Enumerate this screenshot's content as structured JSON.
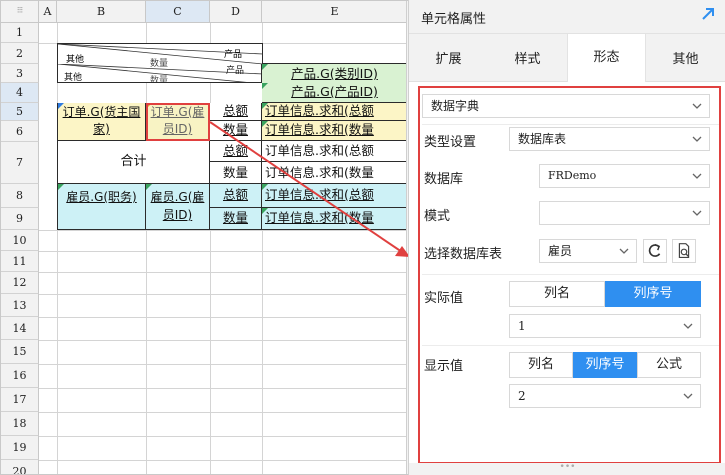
{
  "sheet": {
    "corner_glyph": "⁝⁝⁝",
    "columns": [
      "A",
      "B",
      "C",
      "D",
      "E"
    ],
    "rows": [
      "1",
      "2",
      "3",
      "4",
      "5",
      "6",
      "7",
      "8",
      "9",
      "10",
      "11",
      "12",
      "13",
      "14",
      "15",
      "16",
      "17",
      "18",
      "19",
      "20"
    ],
    "cells": {
      "b2_right": "产品",
      "b2_left": "其他",
      "b2_mid": "数量",
      "e2": "产品.G(类别ID)",
      "e3": "产品.G(产品ID)",
      "b4": "订单.G(货主国家)",
      "c4": "订单.G(雇员ID)",
      "d4": "总额",
      "d5": "数量",
      "e4": "订单信息.求和(总额",
      "e5": "订单信息.求和(数量",
      "b6": "合计",
      "d6": "总额",
      "d7": "数量",
      "e6": "订单信息.求和(总额",
      "e7": "订单信息.求和(数量",
      "b8": "雇员.G(职务)",
      "c8": "雇员.G(雇员ID)",
      "d8": "总额",
      "d9": "数量",
      "e8": "订单信息.求和(总额",
      "e9": "订单信息.求和(数量"
    }
  },
  "panel": {
    "title": "单元格属性",
    "tabs": [
      "扩展",
      "样式",
      "形态",
      "其他"
    ],
    "active_tab": "形态",
    "form_type": "数据字典",
    "type_label": "类型设置",
    "type_value": "数据库表",
    "db_label": "数据库",
    "db_value": "FRDemo",
    "schema_label": "模式",
    "schema_value": "",
    "table_label": "选择数据库表",
    "table_value": "雇员",
    "actual_label": "实际值",
    "actual_options": [
      "列名",
      "列序号"
    ],
    "actual_selected": "列序号",
    "actual_value": "1",
    "display_label": "显示值",
    "display_options": [
      "列名",
      "列序号",
      "公式"
    ],
    "display_selected": "列序号",
    "display_value": "2",
    "grip": "•••"
  },
  "colors": {
    "highlight": "#e0403f",
    "accent": "#2f8ff0",
    "cell_green": "#d9f2d2",
    "cell_yellow": "#fcf5c6",
    "cell_cyan": "#cdf1f6"
  }
}
